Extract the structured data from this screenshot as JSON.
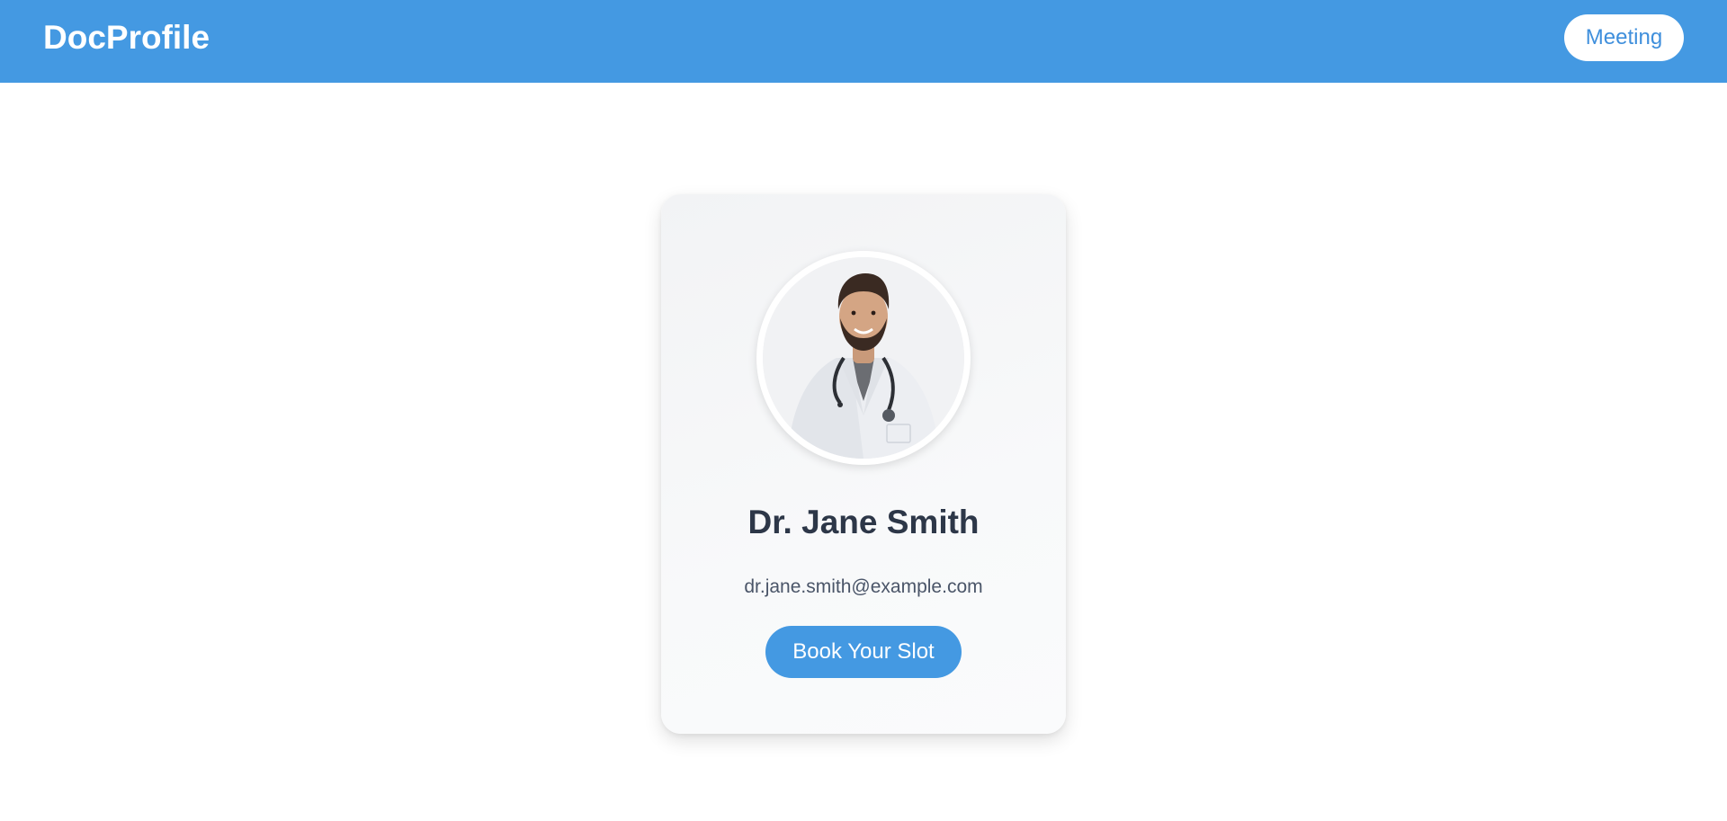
{
  "navbar": {
    "brand": "DocProfile",
    "meeting_label": "Meeting",
    "background_color": "#4499e2"
  },
  "profile_card": {
    "avatar_icon": "doctor-photo",
    "name": "Dr. Jane Smith",
    "email": "dr.jane.smith@example.com",
    "book_label": "Book Your Slot",
    "accent_color": "#4499e2"
  }
}
